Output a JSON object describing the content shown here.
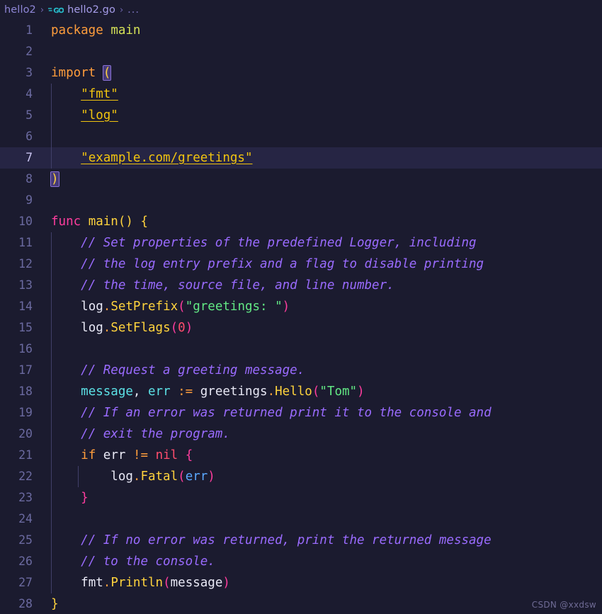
{
  "window": {
    "background": "#1b1b2f",
    "active_line_background": "#262544"
  },
  "breadcrumb": {
    "items": [
      {
        "label": "hello2",
        "icon": null
      },
      {
        "label": "hello2.go",
        "icon": "go-language-icon"
      },
      {
        "label": "...",
        "icon": null
      }
    ],
    "separator": "›",
    "folder_label": "hello2",
    "file_label": "hello2.go",
    "dots_label": "...",
    "icon_name": "go-language-icon",
    "icon_text": "GO",
    "icon_color": "#26b5c4"
  },
  "editor": {
    "language": "go",
    "active_line": 7,
    "gutter_color": "#6b6aa0",
    "lines": [
      {
        "n": 1,
        "text": "package main"
      },
      {
        "n": 2,
        "text": ""
      },
      {
        "n": 3,
        "text": "import ("
      },
      {
        "n": 4,
        "text": "    \"fmt\""
      },
      {
        "n": 5,
        "text": "    \"log\""
      },
      {
        "n": 6,
        "text": ""
      },
      {
        "n": 7,
        "text": "    \"example.com/greetings\""
      },
      {
        "n": 8,
        "text": ")"
      },
      {
        "n": 9,
        "text": ""
      },
      {
        "n": 10,
        "text": "func main() {"
      },
      {
        "n": 11,
        "text": "    // Set properties of the predefined Logger, including"
      },
      {
        "n": 12,
        "text": "    // the log entry prefix and a flag to disable printing"
      },
      {
        "n": 13,
        "text": "    // the time, source file, and line number."
      },
      {
        "n": 14,
        "text": "    log.SetPrefix(\"greetings: \")"
      },
      {
        "n": 15,
        "text": "    log.SetFlags(0)"
      },
      {
        "n": 16,
        "text": ""
      },
      {
        "n": 17,
        "text": "    // Request a greeting message."
      },
      {
        "n": 18,
        "text": "    message, err := greetings.Hello(\"Tom\")"
      },
      {
        "n": 19,
        "text": "    // If an error was returned print it to the console and"
      },
      {
        "n": 20,
        "text": "    // exit the program."
      },
      {
        "n": 21,
        "text": "    if err != nil {"
      },
      {
        "n": 22,
        "text": "        log.Fatal(err)"
      },
      {
        "n": 23,
        "text": "    }"
      },
      {
        "n": 24,
        "text": ""
      },
      {
        "n": 25,
        "text": "    // If no error was returned, print the returned message"
      },
      {
        "n": 26,
        "text": "    // to the console."
      },
      {
        "n": 27,
        "text": "    fmt.Println(message)"
      },
      {
        "n": 28,
        "text": "}"
      }
    ],
    "tokens": {
      "l1_kw": "package",
      "l1_name": "main",
      "l3_kw": "import",
      "l3_paren": "(",
      "l4_str": "\"fmt\"",
      "l5_str": "\"log\"",
      "l7_str": "\"example.com/greetings\"",
      "l8_paren": ")",
      "l10_kw": "func",
      "l10_name": "main",
      "l10_parens": "()",
      "l10_brace": "{",
      "l11_comment": "// Set properties of the predefined Logger, including",
      "l12_comment": "// the log entry prefix and a flag to disable printing",
      "l13_comment": "// the time, source file, and line number.",
      "l14_obj": "log",
      "l14_dot": ".",
      "l14_fn": "SetPrefix",
      "l14_open": "(",
      "l14_str": "\"greetings: \"",
      "l14_close": ")",
      "l15_obj": "log",
      "l15_dot": ".",
      "l15_fn": "SetFlags",
      "l15_open": "(",
      "l15_num": "0",
      "l15_close": ")",
      "l17_comment": "// Request a greeting message.",
      "l18_var1": "message",
      "l18_comma": ", ",
      "l18_var2": "err",
      "l18_assign": " := ",
      "l18_pkg": "greetings",
      "l18_dot": ".",
      "l18_fn": "Hello",
      "l18_open": "(",
      "l18_str": "\"Tom\"",
      "l18_close": ")",
      "l19_comment": "// If an error was returned print it to the console and",
      "l20_comment": "// exit the program.",
      "l21_kw": "if",
      "l21_var": "err",
      "l21_op": "!=",
      "l21_nil": "nil",
      "l21_brace": "{",
      "l22_obj": "log",
      "l22_dot": ".",
      "l22_fn": "Fatal",
      "l22_open": "(",
      "l22_arg": "err",
      "l22_close": ")",
      "l23_brace": "}",
      "l25_comment": "// If no error was returned, print the returned message",
      "l26_comment": "// to the console.",
      "l27_obj": "fmt",
      "l27_dot": ".",
      "l27_fn": "Println",
      "l27_open": "(",
      "l27_arg": "message",
      "l27_close": ")",
      "l28_brace": "}"
    },
    "colors": {
      "keyword": "#ff9d3c",
      "func_keyword": "#ff3d9e",
      "function": "#ffd33d",
      "string": "#62e884",
      "import_string": "#f1c40f",
      "comment": "#9a6bff",
      "number": "#ff4d6d",
      "variable": "#5ce1e6",
      "identifier": "#e8e8f5",
      "bracket_magenta": "#ff3d9e",
      "bracket_gold": "#ffd33d",
      "bracket_match_bg": "#463a78"
    }
  },
  "watermark": {
    "text": "CSDN @xxdsw"
  }
}
